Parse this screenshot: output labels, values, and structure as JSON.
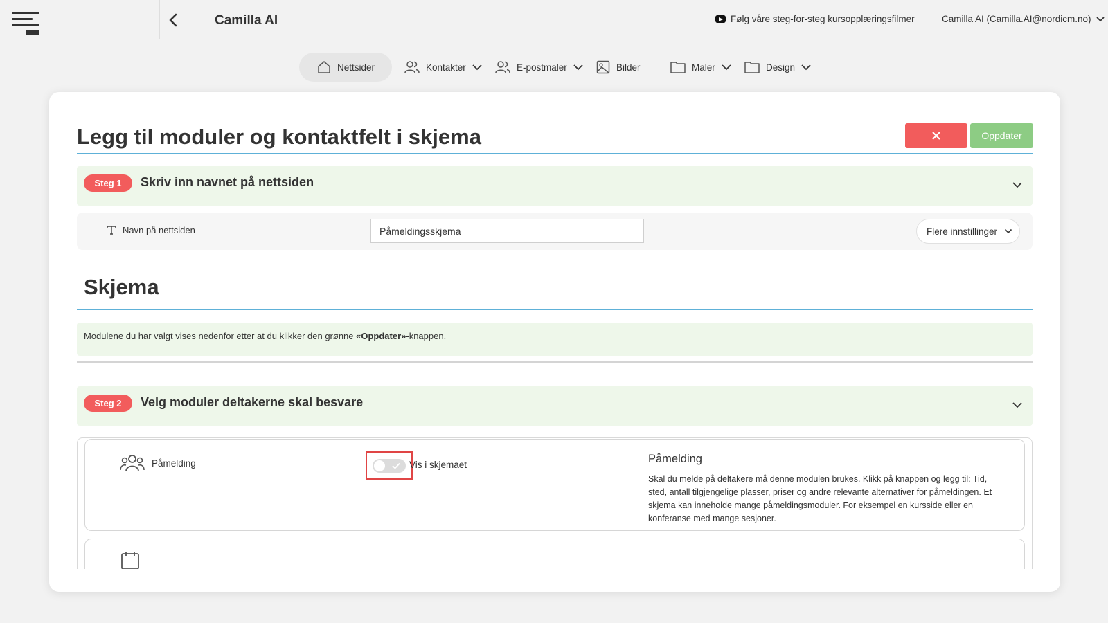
{
  "header": {
    "app_title": "Camilla AI",
    "video_link": "Følg våre steg-for-steg kursopplæringsfilmer",
    "user": "Camilla AI (Camilla.AI@nordicm.no)"
  },
  "nav": {
    "items": [
      {
        "label": "Nettsider",
        "icon": "home-icon",
        "active": true
      },
      {
        "label": "Kontakter",
        "icon": "users-icon",
        "dropdown": true
      },
      {
        "label": "E-postmaler",
        "icon": "users-icon",
        "dropdown": true
      },
      {
        "label": "Bilder",
        "icon": "image-icon"
      },
      {
        "label": "Maler",
        "icon": "folder-icon",
        "dropdown": true
      },
      {
        "label": "Design",
        "icon": "folder-icon",
        "dropdown": true
      }
    ]
  },
  "page": {
    "title": "Legg til moduler og kontaktfelt i skjema",
    "update_button": "Oppdater"
  },
  "step1": {
    "badge": "Steg 1",
    "title": "Skriv inn navnet på nettsiden",
    "field_label": "Navn på nettsiden",
    "field_value": "Påmeldingsskjema",
    "more_settings": "Flere innstillinger"
  },
  "form_section": {
    "title": "Skjema",
    "info_prefix": "Modulene du har valgt vises nedenfor etter at du klikker den grønne ",
    "info_bold": "«Oppdater»",
    "info_suffix": "-knappen."
  },
  "step2": {
    "badge": "Steg 2",
    "title": "Velg moduler deltakerne skal besvare"
  },
  "modules": [
    {
      "name": "Påmelding",
      "icon": "users-group-icon",
      "toggle_label": "Vis i skjemaet",
      "toggle_on": false,
      "desc_title": "Påmelding",
      "desc_text": "Skal du melde på deltakere må denne modulen brukes. Klikk på knappen og legg til: Tid, sted, antall tilgjengelige plasser, priser og andre relevante alternativer for påmeldingen. Et skjema kan inneholde mange påmeldingsmoduler. For eksempel en kursside eller en konferanse med mange sesjoner."
    }
  ],
  "colors": {
    "accent_blue": "#5eb1d8",
    "danger": "#f25c5c",
    "success": "#8dcc84",
    "step_bg": "#eef7ea"
  }
}
